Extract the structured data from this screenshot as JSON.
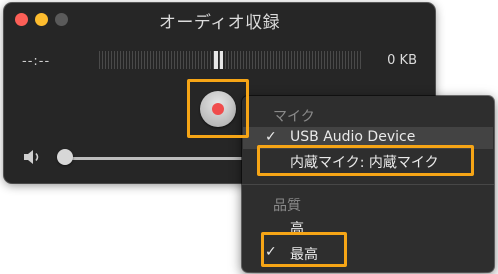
{
  "window": {
    "title": "オーディオ収録",
    "time": "--:--",
    "file_size": "0 KB"
  },
  "controls": {
    "record_icon": "record-icon",
    "volume_icon": "speaker-icon"
  },
  "menu": {
    "microphone_header": "マイク",
    "microphones": [
      {
        "label": "USB Audio Device",
        "checked": true
      },
      {
        "label": "内蔵マイク: 内蔵マイク",
        "checked": false
      }
    ],
    "quality_header": "品質",
    "qualities": [
      {
        "label": "高",
        "checked": false
      },
      {
        "label": "最高",
        "checked": true
      }
    ],
    "check_mark": "✓"
  },
  "colors": {
    "highlight_border": "#f6a516",
    "record_red": "#f04c4c",
    "window_bg": "#262626"
  }
}
